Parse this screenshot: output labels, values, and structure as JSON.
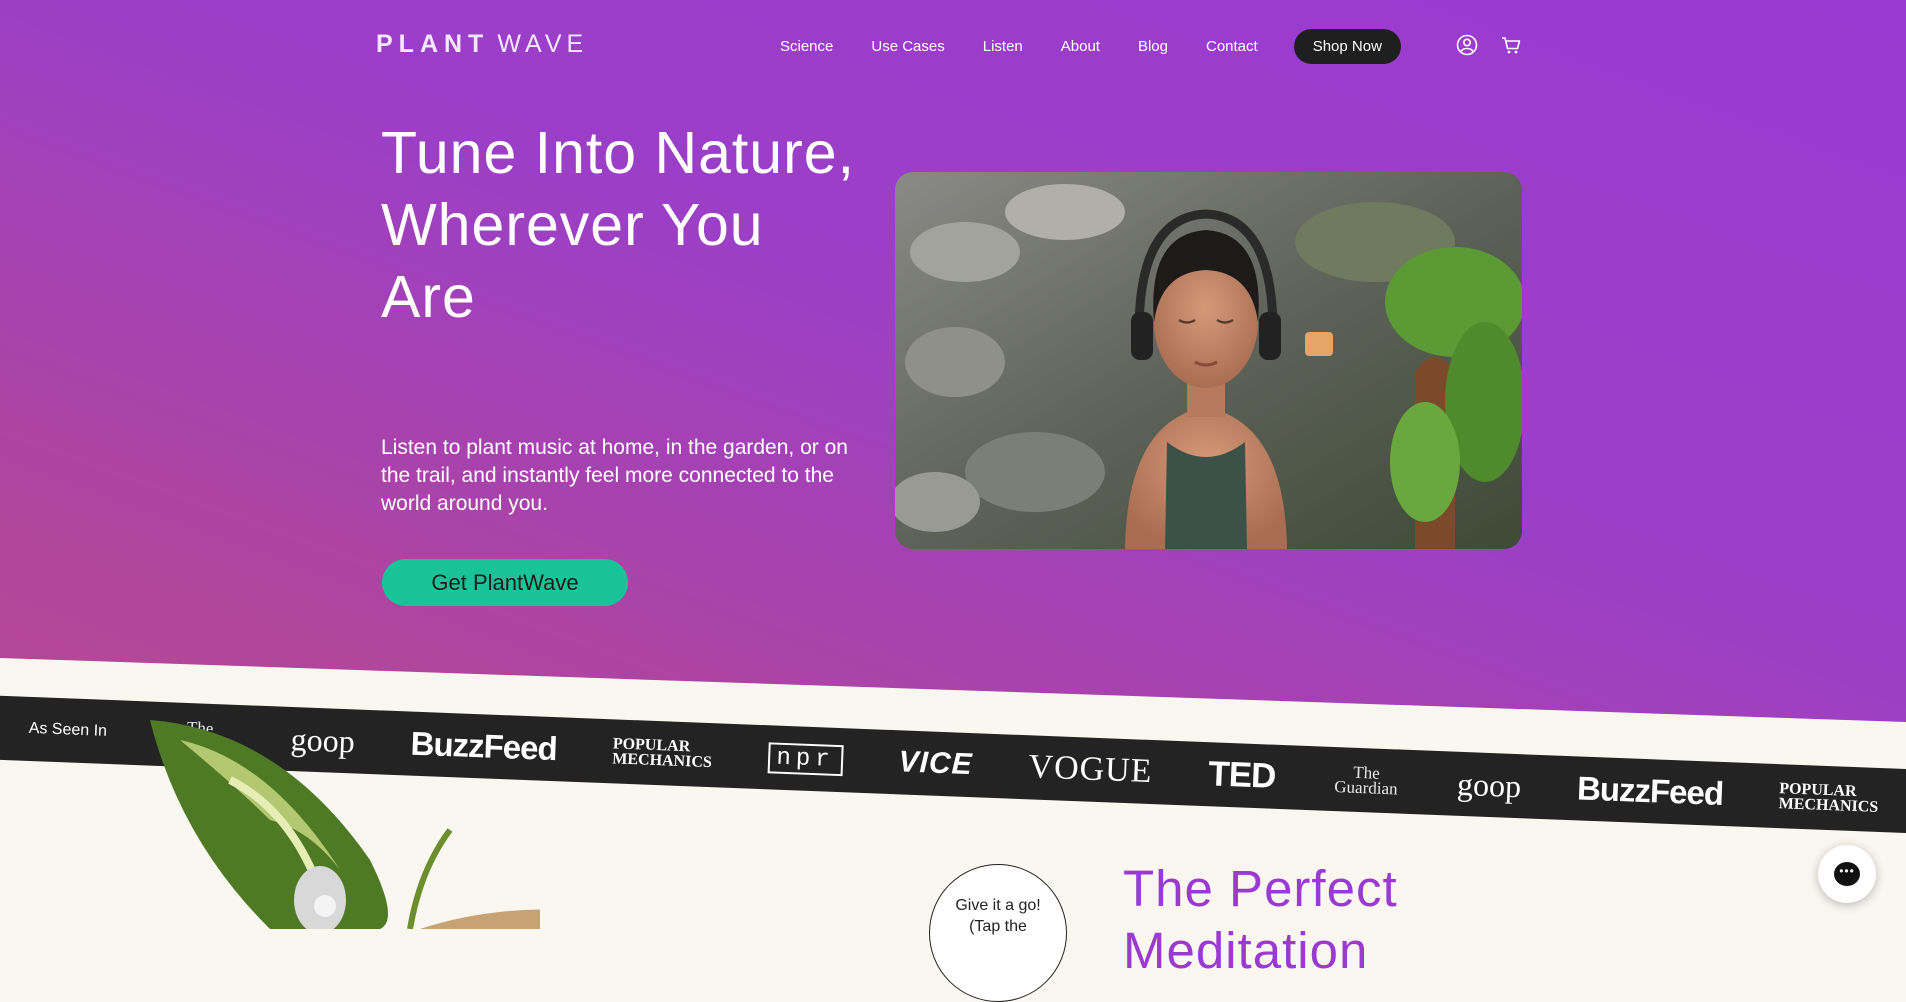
{
  "brand": {
    "logo_bold": "PLANT",
    "logo_light": "WAVE"
  },
  "nav": {
    "links": [
      "Science",
      "Use Cases",
      "Listen",
      "About",
      "Blog",
      "Contact"
    ],
    "shop": "Shop Now",
    "account_icon": "user-circle-icon",
    "cart_icon": "cart-icon"
  },
  "hero": {
    "title": "Tune Into Nature, Wherever You Are",
    "subtitle": "Listen to plant music at home, in the garden, or on the trail, and instantly feel more connected to the world around you.",
    "cta": "Get PlantWave"
  },
  "press": {
    "label": "As Seen In",
    "logos": [
      "The Guardian",
      "goop",
      "BuzzFeed",
      "POPULAR MECHANICS",
      "npr",
      "VICE",
      "VOGUE",
      "TED",
      "The Guardian",
      "goop",
      "BuzzFeed",
      "POPULAR MECHANICS"
    ]
  },
  "section": {
    "bubble_line1": "Give it a go!",
    "bubble_line2": "(Tap the",
    "title": "The Perfect Meditation"
  },
  "chat": {
    "icon": "chat-bubble-icon",
    "label": "•••"
  },
  "colors": {
    "hero_purple": "#9a3ad2",
    "hero_magenta": "#b84a92",
    "cta_green": "#17c397",
    "band_dark": "#232323",
    "cream": "#faf6f0",
    "accent_purple": "#9a3ad2"
  }
}
